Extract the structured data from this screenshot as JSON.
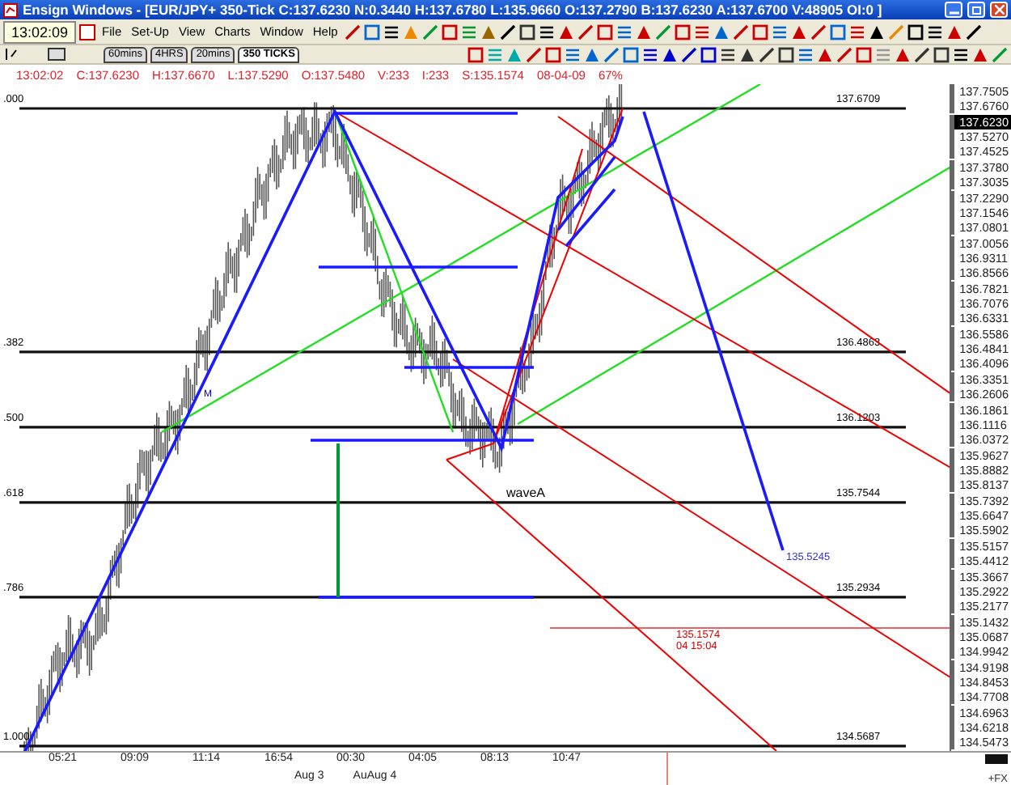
{
  "window": {
    "title": "Ensign Windows - [EUR/JPY+ 350-Tick C:137.6230 N:0.3440 H:137.6780 L:135.9660 O:137.2790 B:137.6230 A:137.6700 V:48905 OI:0 ]"
  },
  "clock": "13:02:09",
  "menu": [
    "File",
    "Set-Up",
    "View",
    "Charts",
    "Window",
    "Help"
  ],
  "tabs": [
    {
      "label": "60mins",
      "selected": false
    },
    {
      "label": "4HRS",
      "selected": false
    },
    {
      "label": "20mins",
      "selected": false
    },
    {
      "label": "350 TICKS",
      "selected": true
    }
  ],
  "info_line": [
    "13:02:02",
    "C:137.6230",
    "H:137.6670",
    "L:137.5290",
    "O:137.5480",
    "V:233",
    "I:233",
    "S:135.1574",
    "08-04-09",
    "67%"
  ],
  "fib_levels": [
    {
      "ratio": ".000",
      "price": "137.6709"
    },
    {
      "ratio": ".382",
      "price": "136.4863"
    },
    {
      "ratio": ".500",
      "price": "136.1203"
    },
    {
      "ratio": ".618",
      "price": "135.7544"
    },
    {
      "ratio": ".786",
      "price": "135.2934"
    },
    {
      "ratio": "1.000",
      "price": "134.5687"
    }
  ],
  "annotations": [
    {
      "kind": "label",
      "text": "waveA"
    },
    {
      "kind": "marker",
      "text": "M"
    },
    {
      "kind": "projection",
      "text": "135.5245"
    },
    {
      "kind": "cursor",
      "text": "135.1574",
      "subtext": "04 15:04"
    }
  ],
  "price_axis": [
    {
      "label": "137.7505",
      "highlighted": false
    },
    {
      "label": "137.6760",
      "highlighted": false
    },
    {
      "label": "137.6230",
      "highlighted": true
    },
    {
      "label": "137.5270",
      "highlighted": false
    },
    {
      "label": "137.4525",
      "highlighted": false
    },
    {
      "label": "137.3780",
      "highlighted": false
    },
    {
      "label": "137.3035",
      "highlighted": false
    },
    {
      "label": "137.2290",
      "highlighted": false
    },
    {
      "label": "137.1546",
      "highlighted": false
    },
    {
      "label": "137.0801",
      "highlighted": false
    },
    {
      "label": "137.0056",
      "highlighted": false
    },
    {
      "label": "136.9311",
      "highlighted": false
    },
    {
      "label": "136.8566",
      "highlighted": false
    },
    {
      "label": "136.7821",
      "highlighted": false
    },
    {
      "label": "136.7076",
      "highlighted": false
    },
    {
      "label": "136.6331",
      "highlighted": false
    },
    {
      "label": "136.5586",
      "highlighted": false
    },
    {
      "label": "136.4841",
      "highlighted": false
    },
    {
      "label": "136.4096",
      "highlighted": false
    },
    {
      "label": "136.3351",
      "highlighted": false
    },
    {
      "label": "136.2606",
      "highlighted": false
    },
    {
      "label": "136.1861",
      "highlighted": false
    },
    {
      "label": "136.1116",
      "highlighted": false
    },
    {
      "label": "136.0372",
      "highlighted": false
    },
    {
      "label": "135.9627",
      "highlighted": false
    },
    {
      "label": "135.8882",
      "highlighted": false
    },
    {
      "label": "135.8137",
      "highlighted": false
    },
    {
      "label": "135.7392",
      "highlighted": false
    },
    {
      "label": "135.6647",
      "highlighted": false
    },
    {
      "label": "135.5902",
      "highlighted": false
    },
    {
      "label": "135.5157",
      "highlighted": false
    },
    {
      "label": "135.4412",
      "highlighted": false
    },
    {
      "label": "135.3667",
      "highlighted": false
    },
    {
      "label": "135.2922",
      "highlighted": false
    },
    {
      "label": "135.2177",
      "highlighted": false
    },
    {
      "label": "135.1432",
      "highlighted": false
    },
    {
      "label": "135.0687",
      "highlighted": false
    },
    {
      "label": "134.9942",
      "highlighted": false
    },
    {
      "label": "134.9198",
      "highlighted": false
    },
    {
      "label": "134.8453",
      "highlighted": false
    },
    {
      "label": "134.7708",
      "highlighted": false
    },
    {
      "label": "134.6963",
      "highlighted": false
    },
    {
      "label": "134.6218",
      "highlighted": false
    },
    {
      "label": "134.5473",
      "highlighted": false
    }
  ],
  "time_axis": [
    "05:21",
    "09:09",
    "11:14",
    "16:54",
    "00:30",
    "04:05",
    "08:13",
    "10:47"
  ],
  "date_axis": [
    "Aug 3",
    "AuAug 4"
  ],
  "corner_label": "+FX"
}
